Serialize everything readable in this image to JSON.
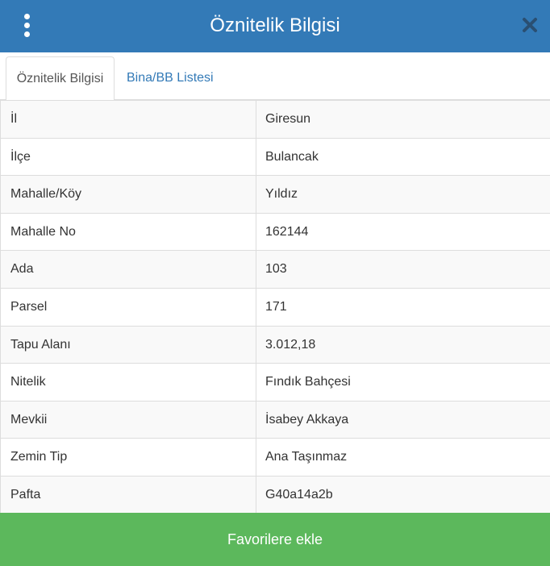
{
  "header": {
    "title": "Öznitelik Bilgisi",
    "menu_icon": "more-vertical-icon",
    "close_icon": "close-icon",
    "bg_color": "#337ab7"
  },
  "tabs": [
    {
      "label": "Öznitelik Bilgisi",
      "active": true
    },
    {
      "label": "Bina/BB Listesi",
      "active": false
    }
  ],
  "attributes": [
    {
      "key": "İl",
      "value": "Giresun"
    },
    {
      "key": "İlçe",
      "value": "Bulancak"
    },
    {
      "key": "Mahalle/Köy",
      "value": "Yıldız"
    },
    {
      "key": "Mahalle No",
      "value": "162144"
    },
    {
      "key": "Ada",
      "value": "103"
    },
    {
      "key": "Parsel",
      "value": "171"
    },
    {
      "key": "Tapu Alanı",
      "value": "3.012,18"
    },
    {
      "key": "Nitelik",
      "value": "Fındık Bahçesi"
    },
    {
      "key": "Mevkii",
      "value": "İsabey Akkaya"
    },
    {
      "key": "Zemin Tip",
      "value": "Ana Taşınmaz"
    },
    {
      "key": "Pafta",
      "value": "G40a14a2b"
    }
  ],
  "footer": {
    "favorite_label": "Favorilere ekle",
    "button_color": "#5cb85c"
  }
}
